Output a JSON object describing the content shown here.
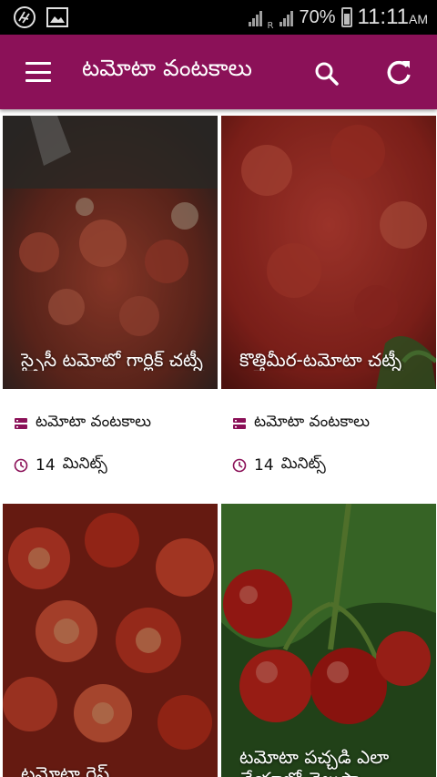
{
  "status_bar": {
    "battery": "70%",
    "time": "11:11",
    "ampm": "AM",
    "network_label": "R"
  },
  "app_bar": {
    "title": "టమోటా వంటకాలు"
  },
  "colors": {
    "app_bar": "#8b1158",
    "accent_icon": "#8b1158"
  },
  "recipes": [
    {
      "title": "స్పైసీ టమోటో గార్లిక్ చట్నీ",
      "category": "టమోటా వంటకాలు",
      "time_value": "14",
      "time_unit": "మినిట్స్"
    },
    {
      "title": "కొత్తిమీర-టమోటా చట్నీ",
      "category": "టమోటా వంటకాలు",
      "time_value": "14",
      "time_unit": "మినిట్స్"
    },
    {
      "title": "టమోటా రైస్",
      "category": "",
      "time_value": "",
      "time_unit": ""
    },
    {
      "title": "టమోటా పచ్చడి ఎలా చేయాలో తెలుసా",
      "category": "",
      "time_value": "",
      "time_unit": ""
    }
  ]
}
